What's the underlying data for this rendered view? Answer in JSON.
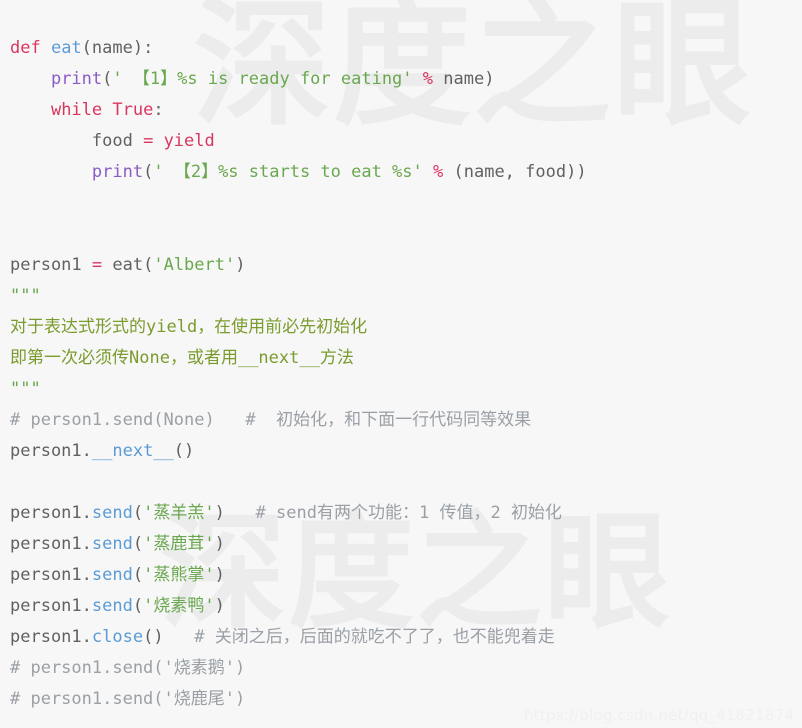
{
  "watermark": {
    "brand_text": "深度之眼",
    "url_text": "https://blog.csdn.net/qq_41821874"
  },
  "colors": {
    "background": "#f7f7f7",
    "keyword": "#d9365e",
    "function": "#5b9bd5",
    "builtin": "#8a5cc4",
    "string": "#6aa84f",
    "comment": "#9aa0a6",
    "docstring": "#7a9c2e",
    "default": "#616161",
    "watermark": "#ececed"
  },
  "code": {
    "language": "python",
    "lines": [
      {
        "n": 1,
        "tokens": [
          {
            "t": "def ",
            "c": "keyword"
          },
          {
            "t": "eat",
            "c": "func"
          },
          {
            "t": "(name):",
            "c": "default"
          }
        ]
      },
      {
        "n": 2,
        "tokens": [
          {
            "t": "    ",
            "c": "default"
          },
          {
            "t": "print",
            "c": "builtin"
          },
          {
            "t": "(",
            "c": "punct"
          },
          {
            "t": "' 【1】%s is ready for eating'",
            "c": "string"
          },
          {
            "t": " ",
            "c": "default"
          },
          {
            "t": "%",
            "c": "operator"
          },
          {
            "t": " name)",
            "c": "default"
          }
        ]
      },
      {
        "n": 3,
        "tokens": [
          {
            "t": "    ",
            "c": "default"
          },
          {
            "t": "while True",
            "c": "keyword"
          },
          {
            "t": ":",
            "c": "default"
          }
        ]
      },
      {
        "n": 4,
        "tokens": [
          {
            "t": "        food ",
            "c": "default"
          },
          {
            "t": "=",
            "c": "operator"
          },
          {
            "t": " ",
            "c": "default"
          },
          {
            "t": "yield",
            "c": "keyword"
          }
        ]
      },
      {
        "n": 5,
        "tokens": [
          {
            "t": "        ",
            "c": "default"
          },
          {
            "t": "print",
            "c": "builtin"
          },
          {
            "t": "(",
            "c": "punct"
          },
          {
            "t": "' 【2】%s starts to eat %s'",
            "c": "string"
          },
          {
            "t": " ",
            "c": "default"
          },
          {
            "t": "%",
            "c": "operator"
          },
          {
            "t": " (name, food))",
            "c": "default"
          }
        ]
      },
      {
        "n": 6,
        "tokens": []
      },
      {
        "n": 7,
        "tokens": []
      },
      {
        "n": 8,
        "tokens": [
          {
            "t": "person1 ",
            "c": "default"
          },
          {
            "t": "=",
            "c": "operator"
          },
          {
            "t": " eat(",
            "c": "default"
          },
          {
            "t": "'Albert'",
            "c": "string"
          },
          {
            "t": ")",
            "c": "default"
          }
        ]
      },
      {
        "n": 9,
        "tokens": [
          {
            "t": "\"\"\"",
            "c": "docmark"
          }
        ]
      },
      {
        "n": 10,
        "tokens": [
          {
            "t": "对于表达式形式的yield，在使用前必先初始化",
            "c": "doc"
          }
        ]
      },
      {
        "n": 11,
        "tokens": [
          {
            "t": "即第一次必须传None，或者用__next__方法",
            "c": "doc"
          }
        ]
      },
      {
        "n": 12,
        "tokens": [
          {
            "t": "\"\"\"",
            "c": "docmark"
          }
        ]
      },
      {
        "n": 13,
        "tokens": [
          {
            "t": "# person1.send(None)   #  初始化，和下面一行代码同等效果",
            "c": "comment"
          }
        ]
      },
      {
        "n": 14,
        "tokens": [
          {
            "t": "person1.",
            "c": "default"
          },
          {
            "t": "__next__",
            "c": "func"
          },
          {
            "t": "()",
            "c": "default"
          }
        ]
      },
      {
        "n": 15,
        "tokens": []
      },
      {
        "n": 16,
        "tokens": [
          {
            "t": "person1.",
            "c": "default"
          },
          {
            "t": "send",
            "c": "func"
          },
          {
            "t": "(",
            "c": "punct"
          },
          {
            "t": "'蒸羊羔'",
            "c": "string"
          },
          {
            "t": ")",
            "c": "default"
          },
          {
            "t": "   # send有两个功能：1 传值，2 初始化",
            "c": "comment"
          }
        ]
      },
      {
        "n": 17,
        "tokens": [
          {
            "t": "person1.",
            "c": "default"
          },
          {
            "t": "send",
            "c": "func"
          },
          {
            "t": "(",
            "c": "punct"
          },
          {
            "t": "'蒸鹿茸'",
            "c": "string"
          },
          {
            "t": ")",
            "c": "default"
          }
        ]
      },
      {
        "n": 18,
        "tokens": [
          {
            "t": "person1.",
            "c": "default"
          },
          {
            "t": "send",
            "c": "func"
          },
          {
            "t": "(",
            "c": "punct"
          },
          {
            "t": "'蒸熊掌'",
            "c": "string"
          },
          {
            "t": ")",
            "c": "default"
          }
        ]
      },
      {
        "n": 19,
        "tokens": [
          {
            "t": "person1.",
            "c": "default"
          },
          {
            "t": "send",
            "c": "func"
          },
          {
            "t": "(",
            "c": "punct"
          },
          {
            "t": "'烧素鸭'",
            "c": "string"
          },
          {
            "t": ")",
            "c": "default"
          }
        ]
      },
      {
        "n": 20,
        "tokens": [
          {
            "t": "person1.",
            "c": "default"
          },
          {
            "t": "close",
            "c": "func"
          },
          {
            "t": "()",
            "c": "default"
          },
          {
            "t": "   # 关闭之后，后面的就吃不了了，也不能兜着走",
            "c": "comment"
          }
        ]
      },
      {
        "n": 21,
        "tokens": [
          {
            "t": "# person1.send('烧素鹅')",
            "c": "comment"
          }
        ]
      },
      {
        "n": 22,
        "tokens": [
          {
            "t": "# person1.send('烧鹿尾')",
            "c": "comment"
          }
        ]
      }
    ]
  }
}
